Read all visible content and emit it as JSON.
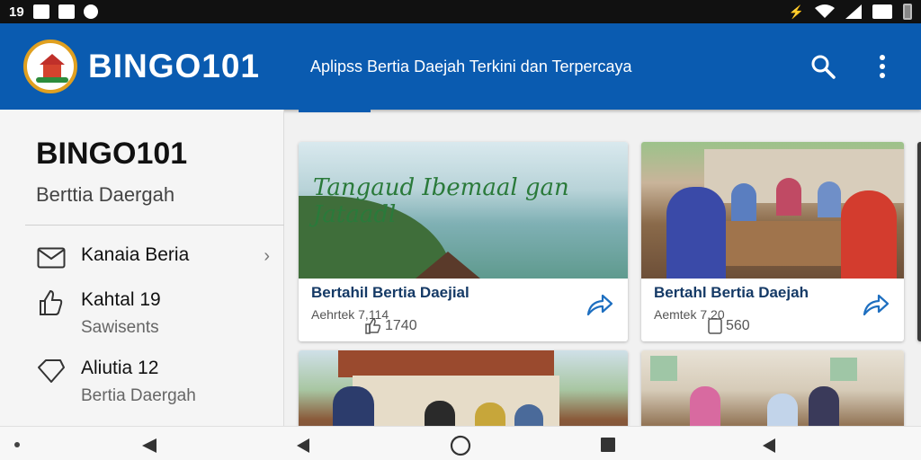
{
  "status_bar": {
    "time": "19"
  },
  "app_bar": {
    "brand": "BINGO101",
    "tagline": "Aplipss Bertia Daejah Terkini dan Terpercaya"
  },
  "drawer": {
    "title": "BINGO101",
    "subtitle": "Berttia Daergah",
    "items": [
      {
        "icon": "mail-icon",
        "label": "Kanaia Beria",
        "sub": ""
      },
      {
        "icon": "thumb-icon",
        "label": "Kahtal 19",
        "sub": "Sawisents"
      },
      {
        "icon": "badge-icon",
        "label": "Aliutia 12",
        "sub": "Bertia Daergah"
      }
    ]
  },
  "cards": [
    {
      "image_caption": "Tangaud Ibemaal gan Jataadl",
      "title": "Bertahil Bertia Daejial",
      "meta": "Aehrtek 7,114",
      "stat": "1740"
    },
    {
      "image_caption": "",
      "title": "Bertahl Bertia Daejah",
      "meta": "Aemtek 7,20",
      "stat": "560"
    },
    {
      "image_caption": "",
      "title": "",
      "meta": "",
      "stat": ""
    },
    {
      "image_caption": "",
      "title": "",
      "meta": "",
      "stat": ""
    }
  ],
  "colors": {
    "app_bar": "#0a5bb0",
    "title_text": "#153a66",
    "share_icon": "#1e6fc0"
  }
}
